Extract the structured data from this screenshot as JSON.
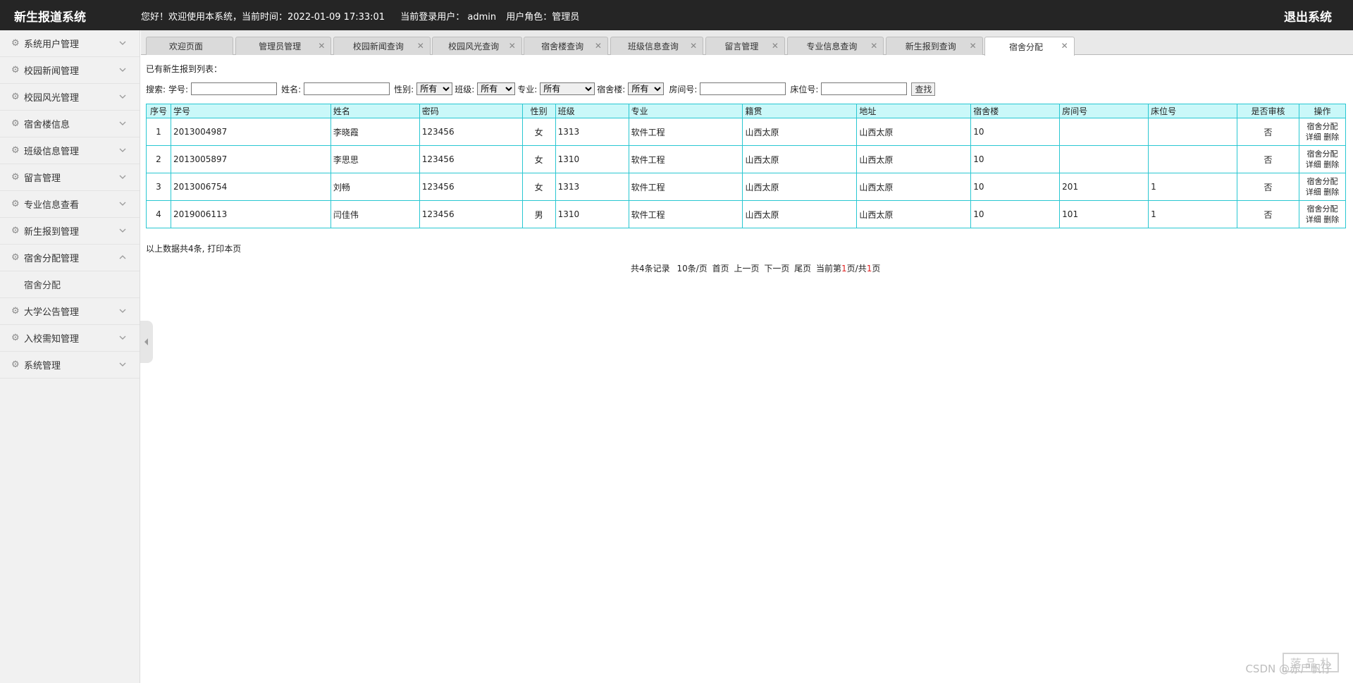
{
  "header": {
    "brand": "新生报道系统",
    "welcome": "您好！欢迎使用本系统，当前时间：2022-01-09 17:33:01",
    "user": "当前登录用户： admin",
    "role": "用户角色：管理员",
    "logout": "退出系统"
  },
  "sidebar": {
    "items": [
      {
        "label": "系统用户管理"
      },
      {
        "label": "校园新闻管理"
      },
      {
        "label": "校园风光管理"
      },
      {
        "label": "宿舍楼信息"
      },
      {
        "label": "班级信息管理"
      },
      {
        "label": "留言管理"
      },
      {
        "label": "专业信息查看"
      },
      {
        "label": "新生报到管理"
      },
      {
        "label": "宿舍分配管理",
        "expanded": true
      },
      {
        "label": "大学公告管理"
      },
      {
        "label": "入校需知管理"
      },
      {
        "label": "系统管理"
      }
    ],
    "sub_item": "宿舍分配"
  },
  "tabs": [
    {
      "label": "欢迎页面",
      "closable": false
    },
    {
      "label": "管理员管理",
      "closable": true
    },
    {
      "label": "校园新闻查询",
      "closable": true
    },
    {
      "label": "校园风光查询",
      "closable": true
    },
    {
      "label": "宿舍楼查询",
      "closable": true
    },
    {
      "label": "班级信息查询",
      "closable": true
    },
    {
      "label": "留言管理",
      "closable": true
    },
    {
      "label": "专业信息查询",
      "closable": true
    },
    {
      "label": "新生报到查询",
      "closable": true
    },
    {
      "label": "宿舍分配",
      "closable": true,
      "active": true
    }
  ],
  "main": {
    "list_title": "已有新生报到列表：",
    "search": {
      "label": "搜索:",
      "student_id_label": "学号:",
      "name_label": "姓名:",
      "gender_label": "性别:",
      "gender_value": "所有",
      "class_label": "班级:",
      "class_value": "所有",
      "major_label": "专业:",
      "major_value": "所有",
      "dorm_label": "宿舍楼:",
      "dorm_value": "所有",
      "room_label": "房间号:",
      "bed_label": "床位号:",
      "button": "查找"
    },
    "table": {
      "columns": [
        "序号",
        "学号",
        "姓名",
        "密码",
        "性别",
        "班级",
        "专业",
        "籍贯",
        "地址",
        "宿舍楼",
        "房间号",
        "床位号",
        "是否审核",
        "操作"
      ],
      "rows": [
        {
          "no": "1",
          "sid": "2013004987",
          "name": "李晓霞",
          "pwd": "123456",
          "gender": "女",
          "cls": "1313",
          "major": "软件工程",
          "origin": "山西太原",
          "addr": "山西太原",
          "dorm": "10",
          "room": "",
          "bed": "",
          "audited": "否"
        },
        {
          "no": "2",
          "sid": "2013005897",
          "name": "李思思",
          "pwd": "123456",
          "gender": "女",
          "cls": "1310",
          "major": "软件工程",
          "origin": "山西太原",
          "addr": "山西太原",
          "dorm": "10",
          "room": "",
          "bed": "",
          "audited": "否"
        },
        {
          "no": "3",
          "sid": "2013006754",
          "name": "刘畅",
          "pwd": "123456",
          "gender": "女",
          "cls": "1313",
          "major": "软件工程",
          "origin": "山西太原",
          "addr": "山西太原",
          "dorm": "10",
          "room": "201",
          "bed": "1",
          "audited": "否"
        },
        {
          "no": "4",
          "sid": "2019006113",
          "name": "闫佳伟",
          "pwd": "123456",
          "gender": "男",
          "cls": "1310",
          "major": "软件工程",
          "origin": "山西太原",
          "addr": "山西太原",
          "dorm": "10",
          "room": "101",
          "bed": "1",
          "audited": "否"
        }
      ],
      "ops": {
        "assign": "宿舍分配",
        "detail": "详细",
        "delete": "删除"
      }
    },
    "summary": "以上数据共4条, 打印本页",
    "pager": {
      "total": "共4条记录",
      "per_page": "10条/页",
      "first": "首页",
      "prev": "上一页",
      "next": "下一页",
      "last": "尾页",
      "current_prefix": "当前第",
      "current": "1",
      "current_mid": "页/共",
      "pages": "1",
      "current_suffix": "页"
    }
  },
  "watermark": "CSDN @赤尸帆仔",
  "stamp": "落 品 朴"
}
